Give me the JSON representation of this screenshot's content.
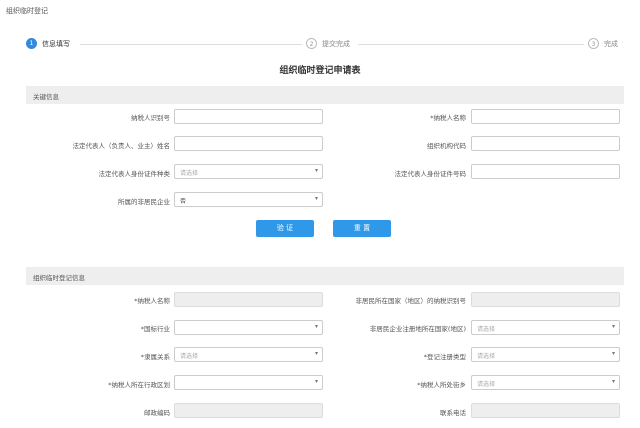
{
  "window": {
    "title": "组织临时登记"
  },
  "steps": [
    {
      "num": "1",
      "label": "信息填写"
    },
    {
      "num": "2",
      "label": "提交完成"
    },
    {
      "num": "3",
      "label": "完成"
    }
  ],
  "form_title": "组织临时登记申请表",
  "section1": {
    "title": "关键信息",
    "taxpayer_id_label": "纳税人识别号",
    "taxpayer_name_label": "*纳税人名称",
    "legal_rep_label": "法定代表人（负责人、业主）姓名",
    "org_code_label": "组织机构代码",
    "id_type_label": "法定代表人身份证件种类",
    "id_type_placeholder": "请选择",
    "id_number_label": "法定代表人身份证件号码",
    "nonresident_label": "所属的非居民企业",
    "nonresident_value": "否"
  },
  "buttons": {
    "verify": "验 证",
    "reset": "重 置"
  },
  "section2": {
    "title": "组织临时登记信息",
    "taxpayer_name_label": "*纳税人名称",
    "home_taxpayer_id_label": "非居民所在国家（地区）的纳税识别号",
    "industry_label": "*国标行业",
    "reg_country_label": "非居民企业注册地所在国家(地区)",
    "reg_country_placeholder": "请选择",
    "affiliation_label": "*隶属关系",
    "affiliation_placeholder": "请选择",
    "reg_type_label": "*登记注册类型",
    "reg_type_placeholder": "请选择",
    "admin_area_label": "*纳税人所在行政区划",
    "tax_nature_label": "*纳税人所处街乡",
    "tax_nature_placeholder": "请选择",
    "postal_label": "邮政编码",
    "phone_label": "联系电话"
  }
}
